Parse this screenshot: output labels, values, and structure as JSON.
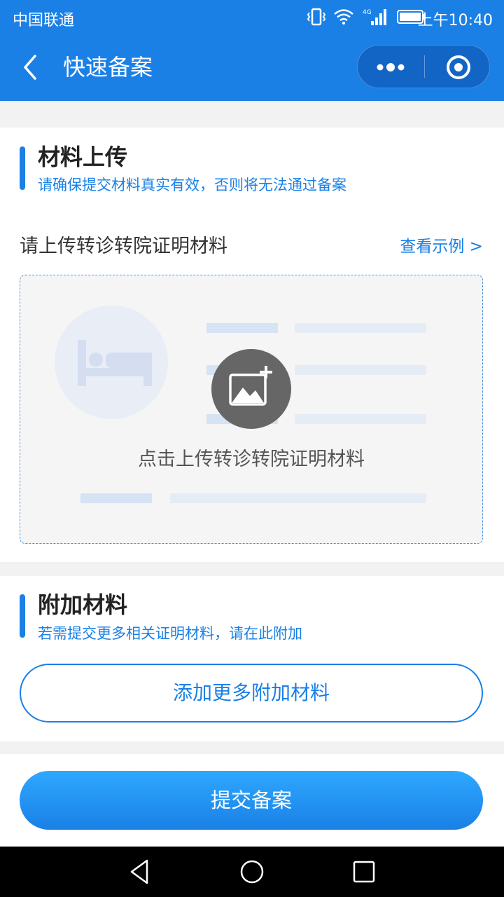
{
  "status_bar": {
    "carrier": "中国联通",
    "network": "4G",
    "time": "上午10:40"
  },
  "nav": {
    "title": "快速备案"
  },
  "materials_section": {
    "title": "材料上传",
    "subtitle": "请确保提交材料真实有效，否则将无法通过备案",
    "upload_label": "请上传转诊转院证明材料",
    "example_link": "查看示例 >",
    "upload_hint": "点击上传转诊转院证明材料"
  },
  "additional_section": {
    "title": "附加材料",
    "subtitle": "若需提交更多相关证明材料，请在此附加",
    "add_button": "添加更多附加材料"
  },
  "submit_button": "提交备案",
  "colors": {
    "primary": "#1a80e6",
    "capsule": "#1265c4",
    "upload_icon_bg": "#666666"
  }
}
